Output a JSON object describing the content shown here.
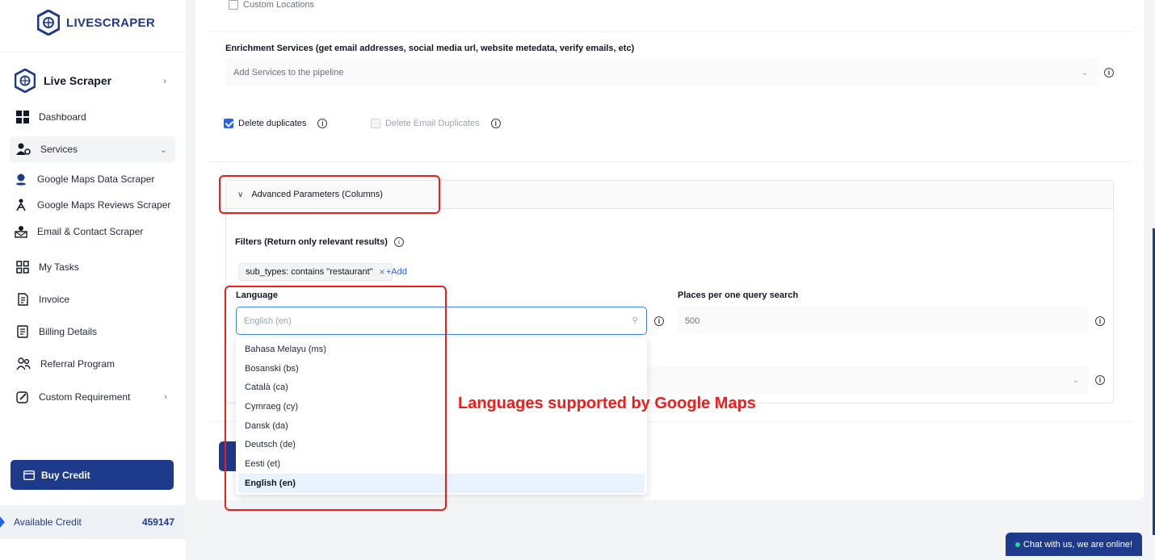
{
  "brand": {
    "name_prefix": "LIVE",
    "name_suffix": "SCRAPER"
  },
  "sidebar": {
    "live_scraper": "Live Scraper",
    "items": [
      {
        "label": "Dashboard",
        "icon": "grid-icon"
      },
      {
        "label": "Services",
        "icon": "users-gear-icon"
      },
      {
        "label": "My Tasks",
        "icon": "tasks-icon"
      },
      {
        "label": "Invoice",
        "icon": "invoice-icon"
      },
      {
        "label": "Billing Details",
        "icon": "billing-icon"
      },
      {
        "label": "Referral Program",
        "icon": "referral-icon"
      },
      {
        "label": "Custom Requirement",
        "icon": "edit-icon"
      }
    ],
    "sub_items": [
      {
        "label": "Google Maps Data Scraper",
        "icon": "map-pin-icon"
      },
      {
        "label": "Google Maps Reviews Scraper",
        "icon": "reviews-icon"
      },
      {
        "label": "Email & Contact Scraper",
        "icon": "email-icon"
      }
    ],
    "buy_credit": "Buy Credit",
    "available_credit_label": "Available Credit",
    "available_credit_value": "459147"
  },
  "form": {
    "custom_locations": "Custom Locations",
    "enrichment_label": "Enrichment Services (get email addresses, social media url, website metedata, verify emails, etc)",
    "enrichment_placeholder": "Add Services to the pipeline",
    "delete_duplicates": "Delete duplicates",
    "delete_email_duplicates": "Delete Email Duplicates",
    "advanced_title": "Advanced Parameters (Columns)",
    "filters_label": "Filters (Return only relevant results)",
    "filter_tag": "sub_types: contains \"restaurant\"",
    "add_link": "+Add",
    "language_label": "Language",
    "language_placeholder": "English (en)",
    "places_label": "Places per one query search",
    "places_value": "500"
  },
  "language_options": [
    "Bahasa Melayu (ms)",
    "Bosanski (bs)",
    "Català (ca)",
    "Cymraeg (cy)",
    "Dansk (da)",
    "Deutsch (de)",
    "Eesti (et)",
    "English (en)"
  ],
  "annotation": "Languages supported by Google Maps",
  "chat": "Chat with us, we are online!",
  "colors": {
    "accent": "#1e3a8a",
    "link": "#2563eb",
    "annotation": "#ef1c1c",
    "selected_option": "#e8f3ff"
  }
}
